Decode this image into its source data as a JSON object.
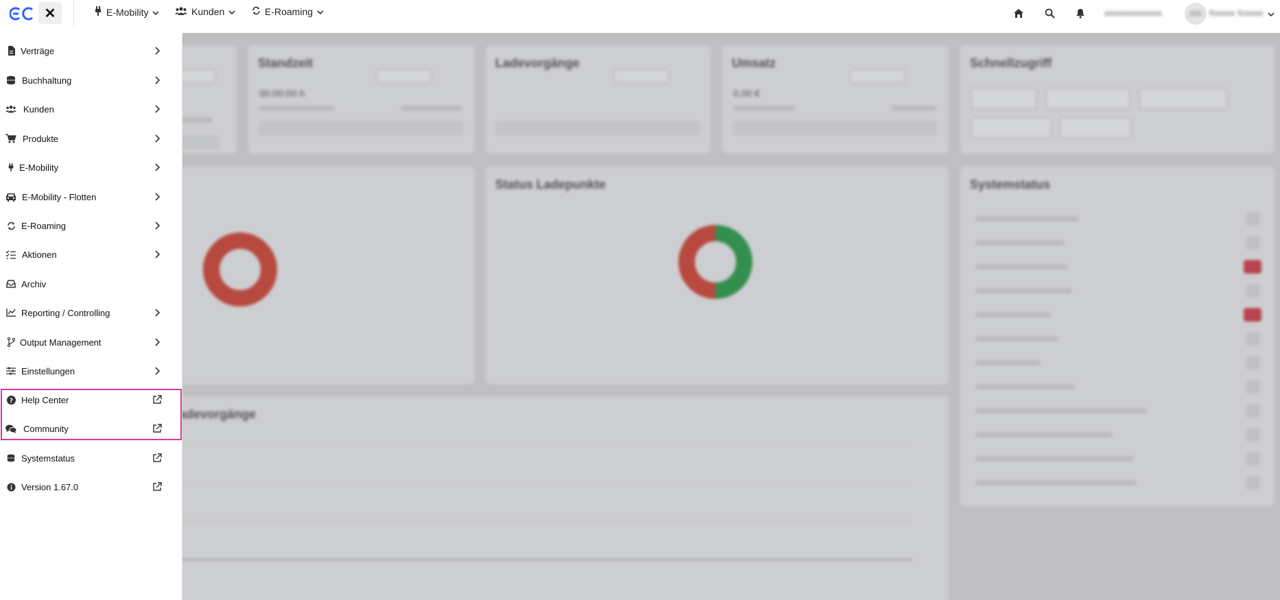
{
  "topbar": {
    "nav": [
      {
        "label": "E-Mobility"
      },
      {
        "label": "Kunden"
      },
      {
        "label": "E-Roaming"
      }
    ],
    "user_org": "xxxxxxxxxxxxxx",
    "user_name": "Xxxxxx Xxxxxx",
    "avatar_text": "XXX"
  },
  "sidebar": {
    "items": [
      {
        "label": "Verträge"
      },
      {
        "label": "Buchhaltung"
      },
      {
        "label": "Kunden"
      },
      {
        "label": "Produkte"
      },
      {
        "label": "E-Mobility"
      },
      {
        "label": "E-Mobility - Flotten"
      },
      {
        "label": "E-Roaming"
      },
      {
        "label": "Aktionen"
      },
      {
        "label": "Archiv"
      },
      {
        "label": "Reporting / Controlling"
      },
      {
        "label": "Output Management"
      },
      {
        "label": "Einstellungen"
      },
      {
        "label": "Help Center"
      },
      {
        "label": "Community"
      },
      {
        "label": "Systemstatus"
      },
      {
        "label": "Version 1.67.0"
      }
    ]
  },
  "dashboard": {
    "standzeit_title": "Standzeit",
    "standzeit_value": "00:00:00 h",
    "standzeit_select": "Tag",
    "ladevorgaenge_title": "Ladevorgänge",
    "ladevorgaenge_select": "Tag",
    "umsatz_title": "Umsatz",
    "umsatz_value": "0,00 €",
    "umsatz_select": "Tag",
    "schnellzugriff_title": "Schnellzugriff",
    "status_ladepunkte_title": "Status Ladepunkte",
    "systemstatus_title": "Systemstatus",
    "chart_title": "Ladevorgänge"
  },
  "colors": {
    "highlight": "#e0359d",
    "accent": "#2962ff",
    "donut_red": "#c0392b",
    "donut_green": "#1e8e3e"
  }
}
